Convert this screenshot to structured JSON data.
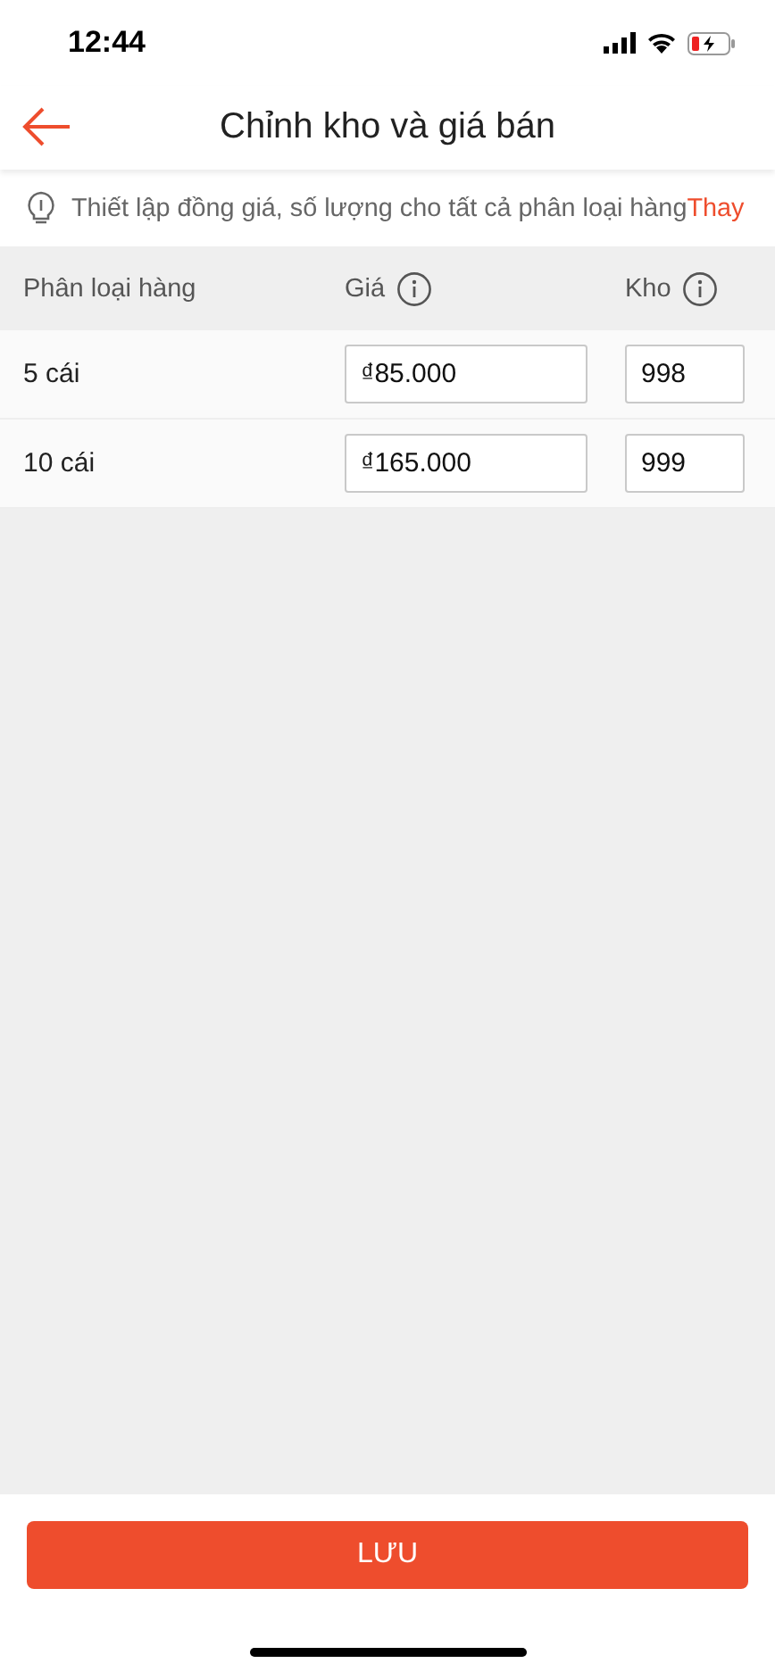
{
  "status_bar": {
    "time": "12:44"
  },
  "header": {
    "title": "Chỉnh kho và giá bán"
  },
  "tip": {
    "text": "Thiết lập đồng giá, số lượng cho tất cả phân loại hàng",
    "link": "Thay"
  },
  "table": {
    "columns": [
      "Phân loại hàng",
      "Giá",
      "Kho"
    ],
    "rows": [
      {
        "variant": "5 cái",
        "price": "₫85.000",
        "stock": "998"
      },
      {
        "variant": "10 cái",
        "price": "₫165.000",
        "stock": "999"
      }
    ]
  },
  "save_button": {
    "label": "LƯU"
  }
}
